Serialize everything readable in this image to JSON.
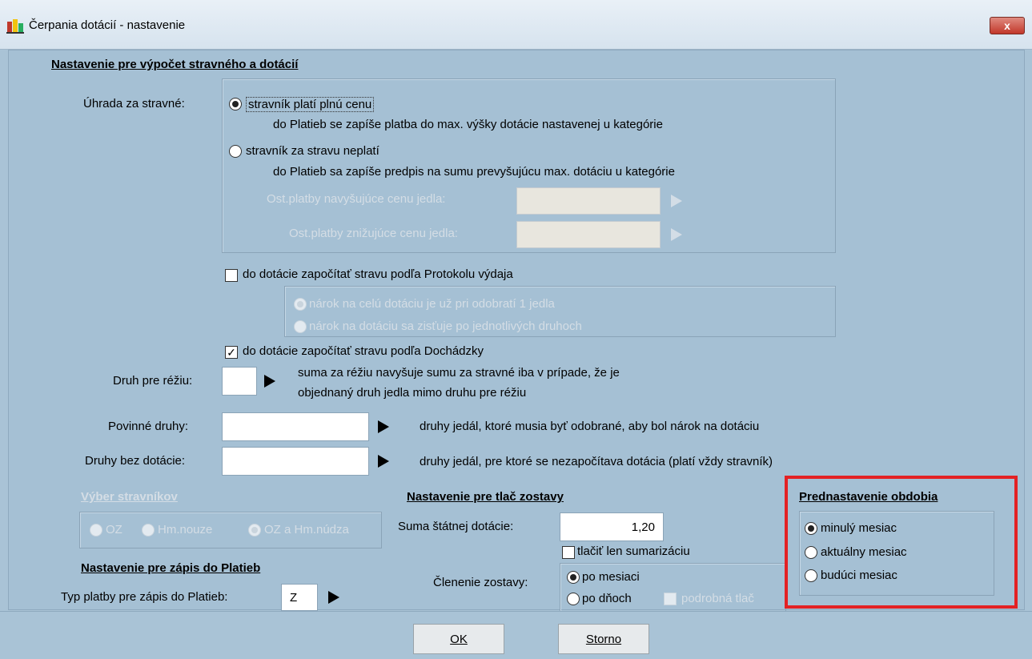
{
  "window": {
    "title": "Čerpania dotácií - nastavenie",
    "close_label": "x"
  },
  "calc": {
    "section_title": "Nastavenie pre výpočet stravného a dotácií",
    "uhrada_label": "Úhrada za stravné:",
    "opt_full_label": "stravník platí plnú cenu",
    "opt_full_desc": "do Platieb se zapíše platba do max. výšky dotácie nastavenej u kategórie",
    "opt_free_label": "stravník za stravu neplatí",
    "opt_free_desc": "do Platieb sa zapíše predpis na sumu prevyšujúcu max. dotáciu u kategórie",
    "ost_up_label": "Ost.platby navyšujúce cenu jedla:",
    "ost_down_label": "Ost.platby znižujúce cenu jedla:",
    "protokol_label": "do dotácie započítať stravu podľa Protokolu výdaja",
    "protokol_opt1": "nárok na celú dotáciu je už pri odobratí 1 jedla",
    "protokol_opt2": "nárok na dotáciu sa zisťuje po jednotlivých druhoch",
    "dochadzka_label": "do dotácie započítať stravu podľa Dochádzky",
    "dochadzka_mark": "✓",
    "rezia_label": "Druh pre réžiu:",
    "rezia_desc1": "suma za réžiu navyšuje sumu za stravné iba v prípade, že je",
    "rezia_desc2": "objednaný druh jedla mimo druhu pre réžiu",
    "povinne_label": "Povinné druhy:",
    "povinne_desc": "druhy jedál, ktoré musia byť odobrané, aby bol nárok na dotáciu",
    "bez_label": "Druhy bez dotácie:",
    "bez_desc": "druhy jedál, pre ktoré se nezapočítava dotácia (platí vždy stravník)"
  },
  "vyber": {
    "title": "Výber stravníkov",
    "opt_oz": "OZ",
    "opt_hm": "Hm.nouze",
    "opt_both": "OZ a Hm.núdza"
  },
  "zapis": {
    "title": "Nastavenie pre zápis do Platieb",
    "typ_label": "Typ platby pre zápis do Platieb:",
    "typ_value": "Z"
  },
  "tlac": {
    "title": "Nastavenie pre tlač zostavy",
    "suma_label": "Suma štátnej dotácie:",
    "suma_value": "1,20",
    "sumar_label": "tlačiť len sumarizáciu",
    "clenenie_label": "Členenie zostavy:",
    "opt_mesiac": "po mesiaci",
    "opt_dni": "po dňoch",
    "podrobna": "podrobná tlač"
  },
  "obdobie": {
    "title": "Prednastavenie obdobia",
    "opt_minuly": "minulý mesiac",
    "opt_aktualny": "aktuálny mesiac",
    "opt_buduci": "budúci mesiac"
  },
  "buttons": {
    "ok": "OK",
    "storno": "Storno"
  }
}
